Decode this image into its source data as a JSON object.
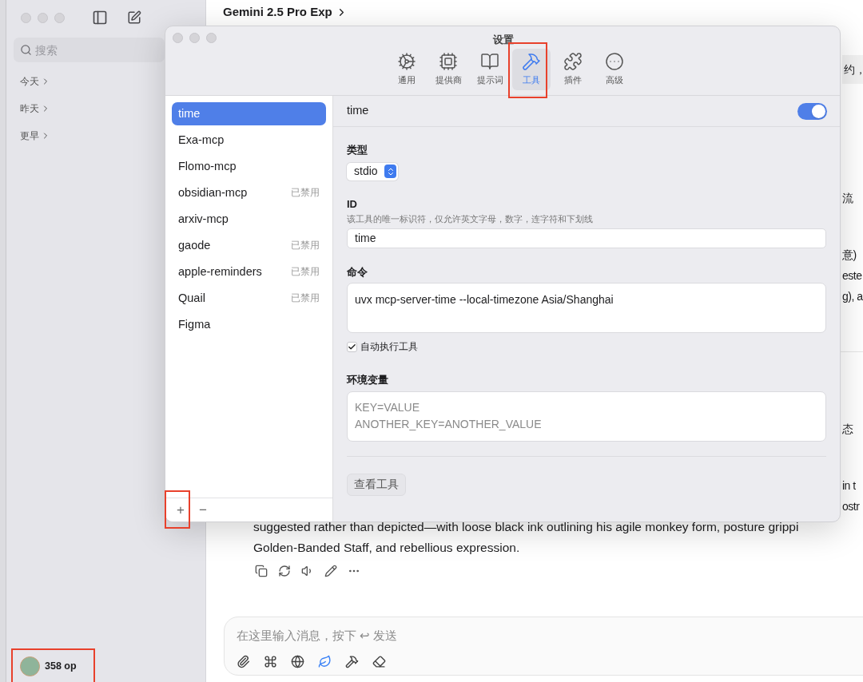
{
  "sidebar": {
    "search": {
      "placeholder": "搜索"
    },
    "groups": [
      {
        "label": "今天"
      },
      {
        "label": "昨天"
      },
      {
        "label": "更早"
      }
    ],
    "user": {
      "name": "358 op"
    }
  },
  "chat": {
    "model": "Gemini 2.5 Pro Exp",
    "fragments": [
      {
        "text": "约，",
        "kind": "bubble"
      },
      {
        "text": "流",
        "kind": "line"
      },
      {
        "text": "意)",
        "kind": "line"
      },
      {
        "text": "este",
        "kind": "line"
      },
      {
        "text": "g), a",
        "kind": "line"
      },
      {
        "text": "态",
        "kind": "line"
      },
      {
        "text": "in t",
        "kind": "line"
      },
      {
        "text": "ostr",
        "kind": "line"
      }
    ],
    "message_lines": [
      "suggested rather than depicted—with loose black ink outlining his agile monkey form, posture grippi",
      "Golden-Banded Staff, and rebellious expression."
    ],
    "actions": [
      {
        "kind": "copy"
      },
      {
        "kind": "regenerate"
      },
      {
        "kind": "speak"
      },
      {
        "kind": "edit"
      },
      {
        "kind": "more"
      }
    ],
    "input": {
      "placeholder": "在这里输入消息，按下 ↩ 发送"
    },
    "input_tools": [
      {
        "kind": "attach",
        "on": false
      },
      {
        "kind": "command",
        "on": false
      },
      {
        "kind": "web",
        "on": false
      },
      {
        "kind": "leaf",
        "on": true
      },
      {
        "kind": "tools",
        "on": false
      },
      {
        "kind": "clear",
        "on": false
      }
    ]
  },
  "settings": {
    "title": "设置",
    "tabs": [
      {
        "label": "通用",
        "kind": "general",
        "selected": false
      },
      {
        "label": "提供商",
        "kind": "provider",
        "selected": false
      },
      {
        "label": "提示词",
        "kind": "prompt",
        "selected": false
      },
      {
        "label": "工具",
        "kind": "tools",
        "selected": true
      },
      {
        "label": "插件",
        "kind": "plugins",
        "selected": false
      },
      {
        "label": "高级",
        "kind": "advanced",
        "selected": false
      }
    ],
    "tools": [
      {
        "name": "time",
        "selected": true
      },
      {
        "name": "Exa-mcp",
        "selected": false
      },
      {
        "name": "Flomo-mcp",
        "selected": false
      },
      {
        "name": "obsidian-mcp",
        "selected": false,
        "status": "已禁用"
      },
      {
        "name": "arxiv-mcp",
        "selected": false
      },
      {
        "name": "gaode",
        "selected": false,
        "status": "已禁用"
      },
      {
        "name": "apple-reminders",
        "selected": false,
        "status": "已禁用"
      },
      {
        "name": "Quail",
        "selected": false,
        "status": "已禁用"
      },
      {
        "name": "Figma",
        "selected": false
      }
    ],
    "list_controls": [
      "+",
      "−"
    ],
    "detail": {
      "name": "time",
      "enabled": true,
      "type_label": "类型",
      "type_value": "stdio",
      "id_label": "ID",
      "id_hint": "该工具的唯一标识符，仅允许英文字母，数字，连字符和下划线",
      "id_value": "time",
      "command_label": "命令",
      "command_value": "uvx mcp-server-time --local-timezone Asia/Shanghai",
      "auto_run_label": "自动执行工具",
      "auto_run": true,
      "env_label": "环境变量",
      "env_placeholder": "KEY=VALUE\nANOTHER_KEY=ANOTHER_VALUE",
      "view_tools": "查看工具"
    }
  }
}
